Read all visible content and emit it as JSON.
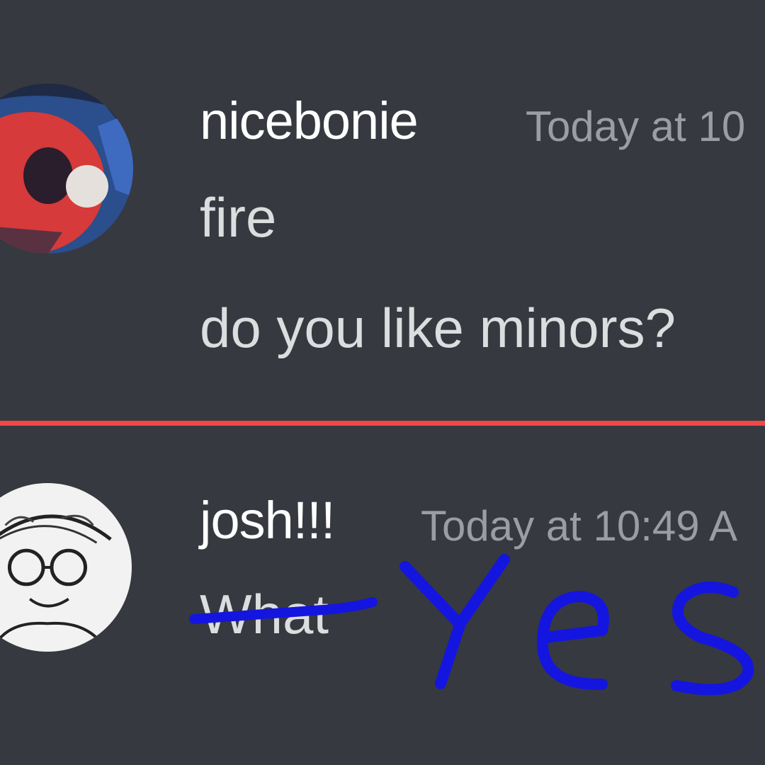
{
  "messages": [
    {
      "username": "nicebonie",
      "timestamp": "Today at 10",
      "lines": [
        "fire",
        "do you like minors?"
      ]
    },
    {
      "username": "josh!!!",
      "timestamp": "Today at 10:49 A",
      "lines": [
        "What"
      ]
    }
  ],
  "divider": {
    "color": "#f04747"
  },
  "annotation": {
    "text": "Yes",
    "color": "#1515e0"
  }
}
